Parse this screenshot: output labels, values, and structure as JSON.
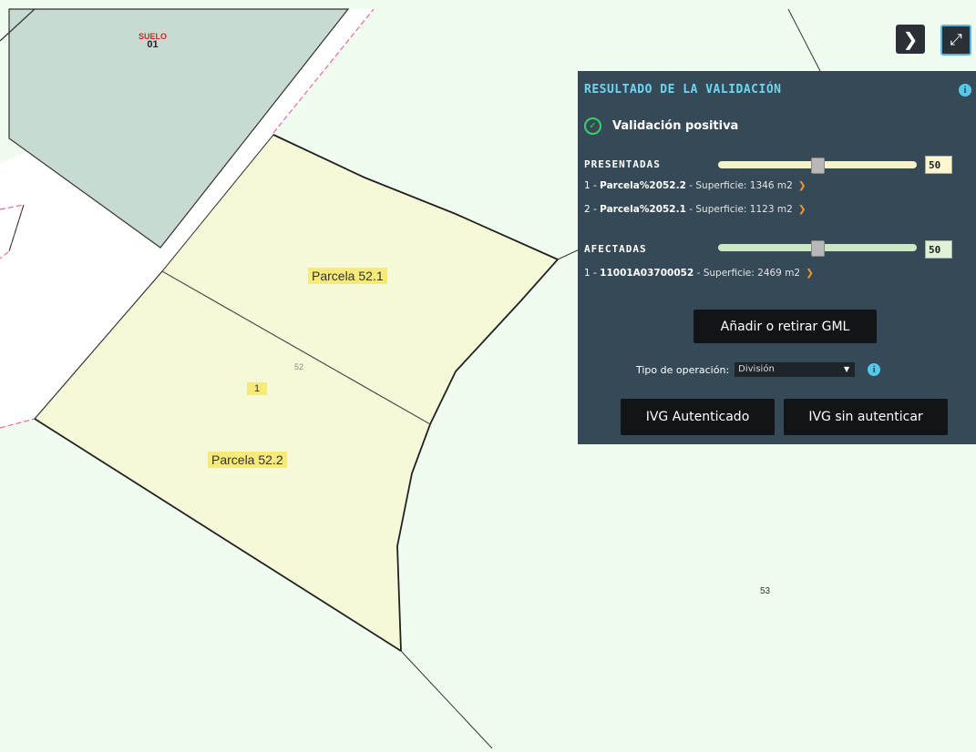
{
  "map": {
    "suelo_label": "SUELO",
    "suelo_number": "01",
    "parcel_label_1": "Parcela 52.1",
    "parcel_label_2": "Parcela 52.2",
    "parcel_number_52": "52",
    "subparcel_number": "1",
    "parcel_number_53": "53"
  },
  "toolbar": {
    "collapse_icon": "chevron-right-icon",
    "expand_icon": "fullscreen-icon"
  },
  "panel": {
    "title": "RESULTADO DE LA VALIDACIÓN",
    "status": "Validación positiva",
    "presentadas": {
      "label": "PRESENTADAS",
      "slider_value": "50",
      "slider_level": 0.5,
      "items": [
        {
          "index": "1 -",
          "name": "Parcela%2052.2",
          "surface": "- Superficie: 1346 m2"
        },
        {
          "index": "2 -",
          "name": "Parcela%2052.1",
          "surface": "- Superficie: 1123 m2"
        }
      ]
    },
    "afectadas": {
      "label": "AFECTADAS",
      "slider_value": "50",
      "slider_level": 0.5,
      "items": [
        {
          "index": "1 -",
          "name": "11001A03700052",
          "surface": "- Superficie: 2469 m2"
        }
      ]
    },
    "gml_button": "Añadir o retirar GML",
    "operation_label": "Tipo de operación:",
    "operation_value": "División",
    "ivg_auth_button": "IVG Autenticado",
    "ivg_noauth_button": "IVG sin autenticar"
  },
  "colors": {
    "panel_bg": "#354a56",
    "title": "#6ed6f0",
    "parcel_fill": "#f5f9d8",
    "block_fill": "#c8dbd1",
    "map_bg": "#f1fcf1",
    "presentadas_slider": "#f6f3c8",
    "afectadas_slider": "#cbe8c2",
    "arrow": "#f29a2e",
    "success": "#3bd06b"
  }
}
